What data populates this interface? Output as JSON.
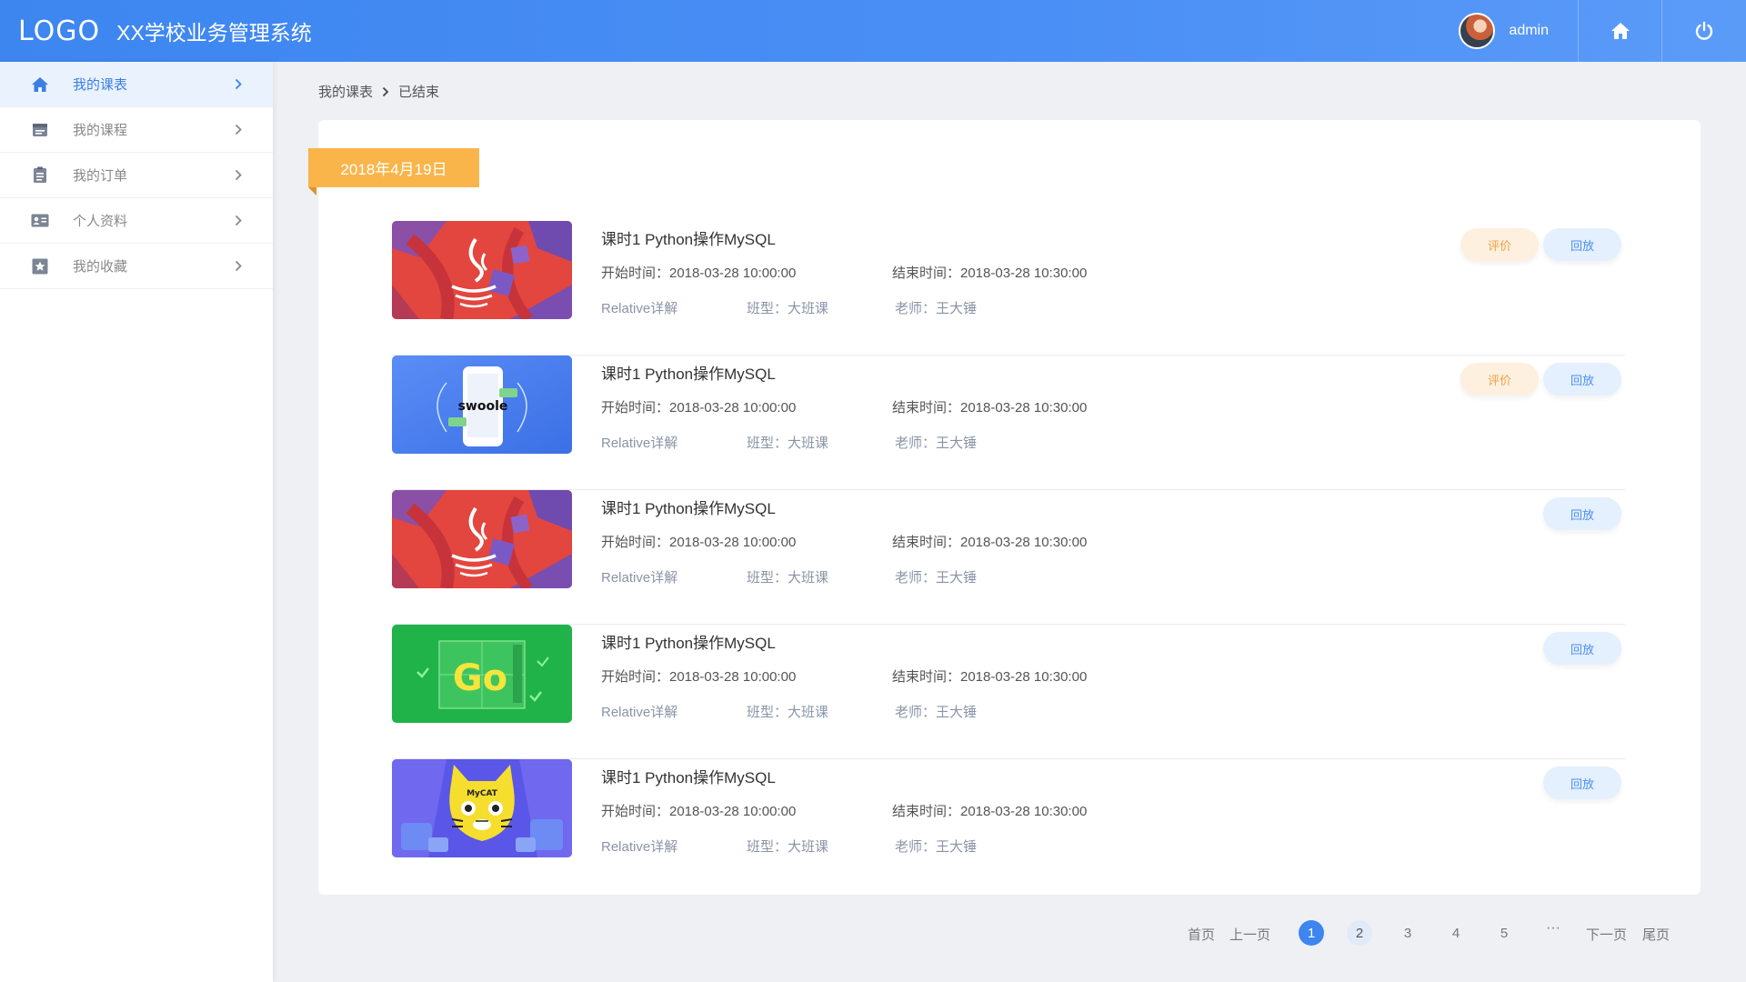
{
  "header": {
    "logo": "LOGO",
    "app_title": "XX学校业务管理系统",
    "user_name": "admin"
  },
  "sidebar": {
    "items": [
      {
        "label": "我的课表",
        "icon": "home-icon",
        "active": true
      },
      {
        "label": "我的课程",
        "icon": "calendar-icon"
      },
      {
        "label": "我的订单",
        "icon": "clipboard-icon"
      },
      {
        "label": "个人资料",
        "icon": "id-card-icon"
      },
      {
        "label": "我的收藏",
        "icon": "star-box-icon"
      }
    ]
  },
  "breadcrumb": {
    "root": "我的课表",
    "current": "已结束"
  },
  "date_tag": "2018年4月19日",
  "courses": [
    {
      "title": "课时1 Python操作MySQL",
      "start": "开始时间：2018-03-28 10:00:00",
      "end": "结束时间：2018-03-28 10:30:00",
      "detail": "Relative详解",
      "class_type": "班型：大班课",
      "teacher": "老师：王大锤",
      "rate_label": "评价",
      "replay_label": "回放",
      "thumb": "java-thumbnail"
    },
    {
      "title": "课时1 Python操作MySQL",
      "start": "开始时间：2018-03-28 10:00:00",
      "end": "结束时间：2018-03-28 10:30:00",
      "detail": "Relative详解",
      "class_type": "班型：大班课",
      "teacher": "老师：王大锤",
      "rate_label": "评价",
      "replay_label": "回放",
      "thumb": "swoole-thumbnail",
      "thumb_text": "swoole"
    },
    {
      "title": "课时1 Python操作MySQL",
      "start": "开始时间：2018-03-28 10:00:00",
      "end": "结束时间：2018-03-28 10:30:00",
      "detail": "Relative详解",
      "class_type": "班型：大班课",
      "teacher": "老师：王大锤",
      "replay_label": "回放",
      "thumb": "java-thumbnail"
    },
    {
      "title": "课时1 Python操作MySQL",
      "start": "开始时间：2018-03-28 10:00:00",
      "end": "结束时间：2018-03-28 10:30:00",
      "detail": "Relative详解",
      "class_type": "班型：大班课",
      "teacher": "老师：王大锤",
      "replay_label": "回放",
      "thumb": "go-thumbnail",
      "thumb_text": "Go"
    },
    {
      "title": "课时1 Python操作MySQL",
      "start": "开始时间：2018-03-28 10:00:00",
      "end": "结束时间：2018-03-28 10:30:00",
      "detail": "Relative详解",
      "class_type": "班型：大班课",
      "teacher": "老师：王大锤",
      "replay_label": "回放",
      "thumb": "mycat-thumbnail",
      "thumb_text": "MyCAT"
    }
  ],
  "pagination": {
    "first": "首页",
    "prev": "上一页",
    "pages": [
      "1",
      "2",
      "3",
      "4",
      "5"
    ],
    "current": "1",
    "ellipsis": "···",
    "next": "下一页",
    "last": "尾页"
  },
  "colors": {
    "primary": "#3d86f0",
    "accent_orange": "#f9b54a",
    "rate_text": "#f0a143",
    "replay_text": "#4c8ef3"
  }
}
